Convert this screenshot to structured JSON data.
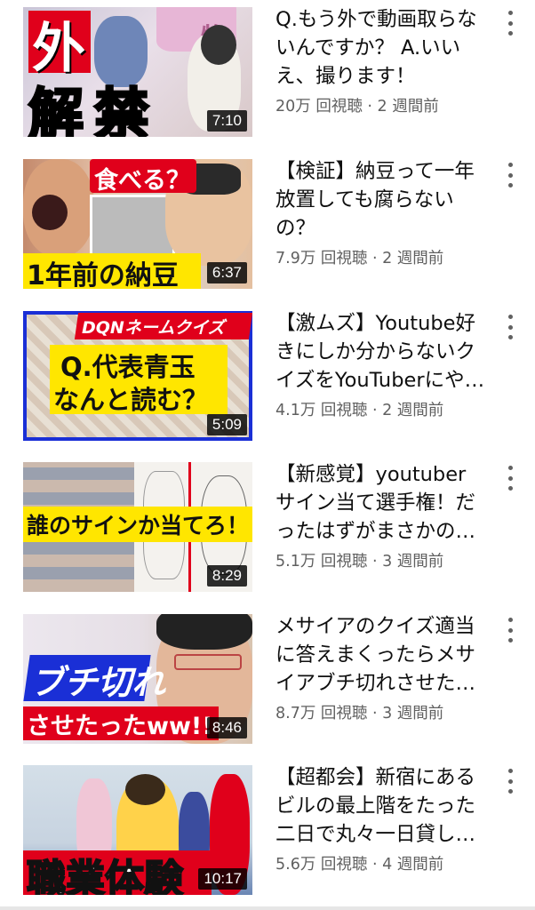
{
  "videos": [
    {
      "title": "Q.もう外で動画取らないんですか？ A.いいえ、撮ります！",
      "stats": "20万 回視聴 · 2 週間前",
      "duration": "7:10",
      "thumb_text": [
        "外",
        "解",
        "禁"
      ],
      "thumb_sign": "物"
    },
    {
      "title": "【検証】納豆って一年放置しても腐らないの？",
      "stats": "7.9万 回視聴 · 2 週間前",
      "duration": "6:37",
      "thumb_text": [
        "食べる？",
        "1年前の納豆"
      ]
    },
    {
      "title": "【激ムズ】Youtube好きにしか分からないクイズをYouTuberにやらせてみた",
      "stats": "4.1万 回視聴 · 2 週間前",
      "duration": "5:09",
      "thumb_text": [
        "DQNネームクイズ",
        "Q.代表青玉",
        "なんと読む？"
      ]
    },
    {
      "title": "【新感覚】youtuberサイン当て選手権！だったはずがまさかの展開に",
      "stats": "5.1万 回視聴 · 3 週間前",
      "duration": "8:29",
      "thumb_text": [
        "誰のサインか当てろ！"
      ]
    },
    {
      "title": "メサイアのクイズ適当に答えまくったらメサイアブチ切れさせたったwww",
      "stats": "8.7万 回視聴 · 3 週間前",
      "duration": "8:46",
      "thumb_text": [
        "ブチ切れ",
        "させたったww!!"
      ]
    },
    {
      "title": "【超都会】新宿にあるビルの最上階をたった二日で丸々一日貸し切ってみた",
      "stats": "5.6万 回視聴 · 4 週間前",
      "duration": "10:17",
      "thumb_text": [
        "職業体験"
      ]
    }
  ],
  "colors": {
    "title": "#0f0f0f",
    "meta": "#606060",
    "duration_bg": "#000000",
    "thumb_red": "#e0001b",
    "thumb_yellow": "#ffe600",
    "thumb_blue": "#1a2fd6"
  },
  "icons": [
    "more-vert-icon"
  ]
}
